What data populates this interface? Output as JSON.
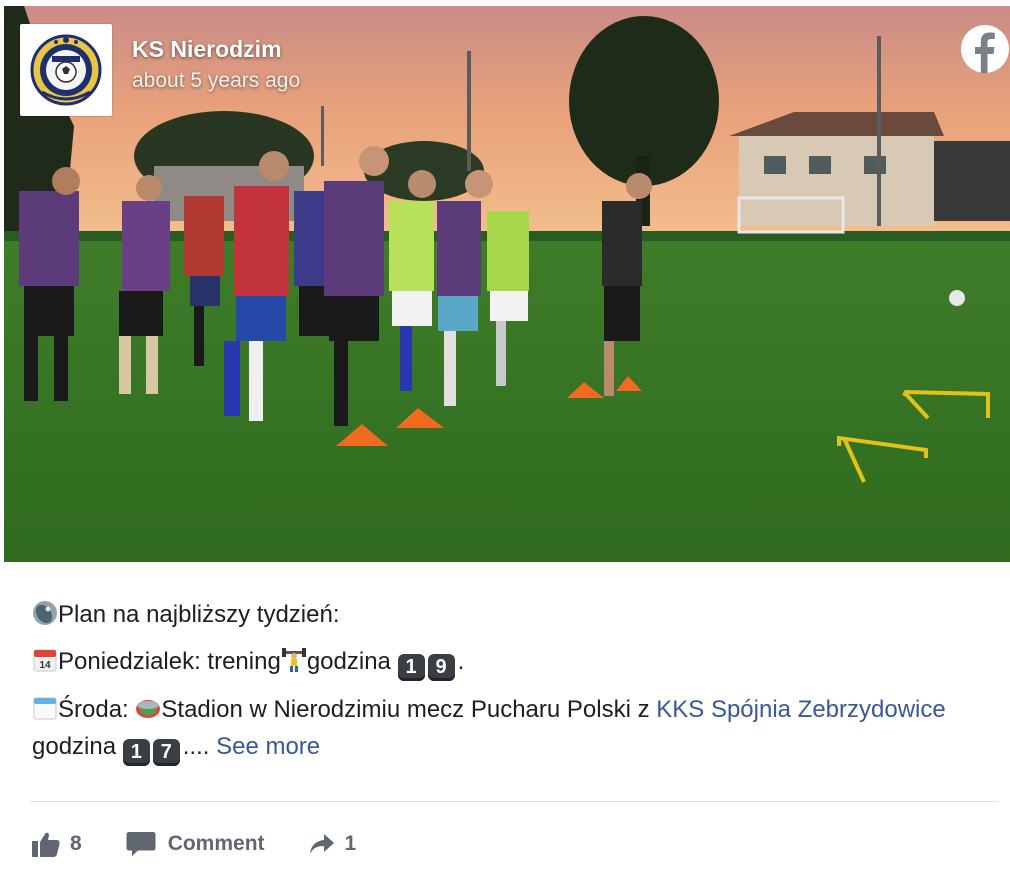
{
  "post": {
    "page_name": "KS Nierodzim",
    "timestamp": "about 5 years ago",
    "avatar_icon": "club-crest-icon",
    "platform_icon": "facebook-logo-icon"
  },
  "content": {
    "line1": {
      "icon": "satellite-dish-icon",
      "text": "Plan na najbliższy tydzień:"
    },
    "line2": {
      "icon": "calendar-14-icon",
      "calendar_day": "14",
      "text_a": "Poniedzialek: trening",
      "icon_b": "weightlifter-icon",
      "text_b": "godzina ",
      "keycaps": [
        "1",
        "9"
      ],
      "text_c": "."
    },
    "line3": {
      "icon": "spiral-calendar-icon",
      "text_a": "Środa: ",
      "icon_b": "stadium-icon",
      "text_b": "Stadion w Nierodzimiu mecz Pucharu Polski z ",
      "link": "KKS Spójnia Zebrzydowice",
      "text_c": " godzina ",
      "keycaps": [
        "1",
        "7"
      ],
      "text_d": "....",
      "see_more": "See more"
    }
  },
  "actions": {
    "likes": "8",
    "comment_label": "Comment",
    "shares": "1"
  },
  "colors": {
    "link": "#385898",
    "action_grey": "#606770",
    "divider": "#dadde1",
    "text": "#1c1e21"
  }
}
